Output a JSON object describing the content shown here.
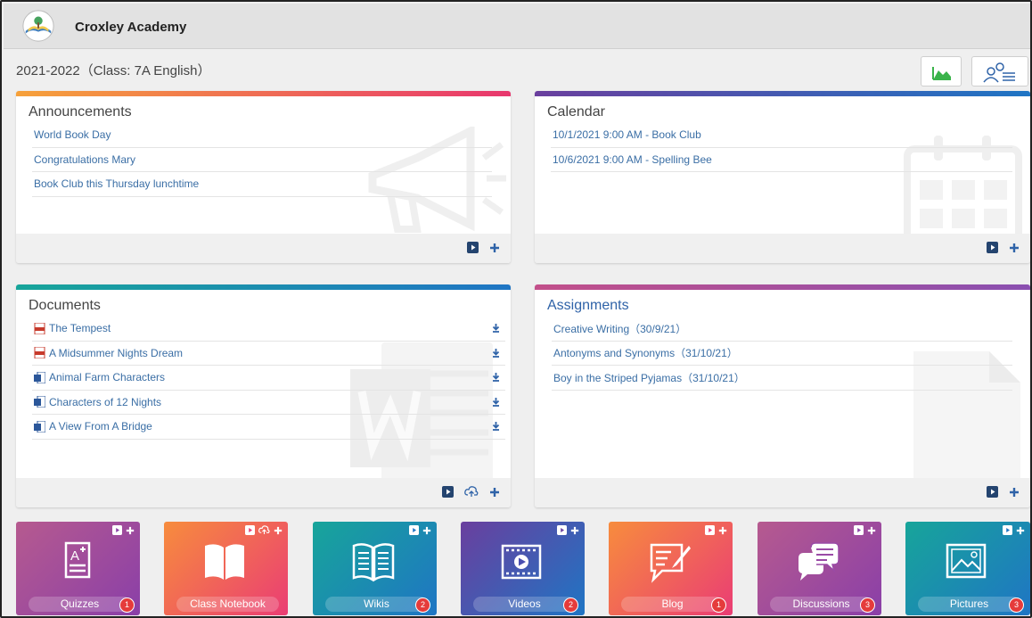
{
  "header": {
    "school_name": "Croxley Academy"
  },
  "class_line": "2021-2022（Class: 7A English）",
  "toolbar": {
    "chart_icon": "area-chart-icon",
    "roster_icon": "roster-list-icon"
  },
  "announcements": {
    "title": "Announcements",
    "items": [
      "World Book Day",
      "Congratulations Mary",
      "Book Club this Thursday lunchtime"
    ]
  },
  "calendar": {
    "title": "Calendar",
    "items": [
      "10/1/2021 9:00 AM - Book Club",
      "10/6/2021 9:00 AM - Spelling Bee"
    ]
  },
  "documents": {
    "title": "Documents",
    "items": [
      {
        "name": "The Tempest",
        "icon": "pdf-icon"
      },
      {
        "name": "A Midsummer Nights Dream",
        "icon": "pdf-icon"
      },
      {
        "name": "Animal Farm Characters",
        "icon": "word-doc-icon"
      },
      {
        "name": "Characters of 12 Nights",
        "icon": "word-doc-icon"
      },
      {
        "name": "A View From A Bridge",
        "icon": "word-doc-icon"
      }
    ]
  },
  "assignments": {
    "title": "Assignments",
    "items": [
      "Creative Writing（30/9/21）",
      "Antonyms and Synonyms（31/10/21）",
      "Boy in the Striped Pyjamas（31/10/21）"
    ]
  },
  "tiles": [
    {
      "label": "Quizzes",
      "badge": "1",
      "icon": "quiz-icon"
    },
    {
      "label": "Class Notebook",
      "badge": "",
      "icon": "notebook-icon"
    },
    {
      "label": "Wikis",
      "badge": "2",
      "icon": "wiki-book-icon"
    },
    {
      "label": "Videos",
      "badge": "2",
      "icon": "video-icon"
    },
    {
      "label": "Blog",
      "badge": "1",
      "icon": "blog-icon"
    },
    {
      "label": "Discussions",
      "badge": "3",
      "icon": "discussion-icon"
    },
    {
      "label": "Pictures",
      "badge": "3",
      "icon": "picture-icon"
    }
  ],
  "colors": {
    "announcements_bar": [
      "#f6a13a",
      "#e8376e"
    ],
    "calendar_bar": [
      "#6a3f9e",
      "#1f75c4"
    ],
    "documents_bar": [
      "#17a59a",
      "#1f75c4"
    ],
    "assignments_bar": [
      "#c24f8a",
      "#8a4fb0"
    ],
    "link": "#3a6ea5",
    "badge": "#e53b3b"
  }
}
